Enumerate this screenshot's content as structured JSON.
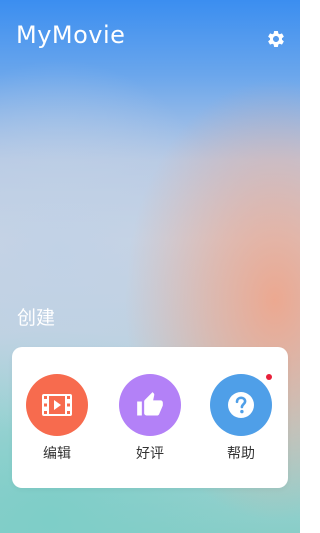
{
  "app": {
    "title": "MyMovie",
    "settings_icon": "gear-icon"
  },
  "section": {
    "label": "创建"
  },
  "actions": [
    {
      "label": "编辑",
      "icon": "film-icon",
      "color": "#f76b4e"
    },
    {
      "label": "好评",
      "icon": "thumbs-up-icon",
      "color": "#b381f7"
    },
    {
      "label": "帮助",
      "icon": "question-icon",
      "color": "#4f9fe8",
      "notification_dot_color": "#e8203a"
    }
  ]
}
